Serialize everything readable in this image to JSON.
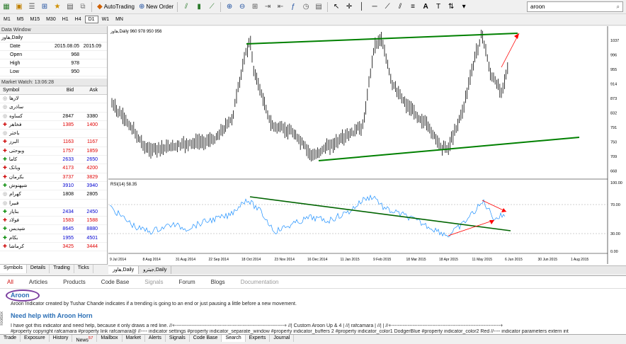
{
  "toolbar": {
    "autotrading": "AutoTrading",
    "new_order": "New Order",
    "search_value": "aroon"
  },
  "timeframes": [
    "M1",
    "M5",
    "M15",
    "M30",
    "H1",
    "H4",
    "D1",
    "W1",
    "MN"
  ],
  "active_timeframe": "D1",
  "data_window": {
    "title": "Data Window",
    "symbol_row": [
      "هاوز,Daily",
      ""
    ],
    "rows": [
      {
        "label": "Date",
        "v1": "2015.08.05",
        "v2": "2015.09"
      },
      {
        "label": "Open",
        "v1": "968",
        "v2": ""
      },
      {
        "label": "High",
        "v1": "978",
        "v2": ""
      },
      {
        "label": "Low",
        "v1": "950",
        "v2": ""
      }
    ]
  },
  "market_watch": {
    "title": "Market Watch: 13:06:28",
    "headers": {
      "symbol": "Symbol",
      "bid": "Bid",
      "ask": "Ask"
    },
    "rows": [
      {
        "symbol": "لازها",
        "bid": "",
        "ask": "",
        "color": ""
      },
      {
        "symbol": "ساذری",
        "bid": "",
        "ask": "",
        "color": ""
      },
      {
        "symbol": "کساوه",
        "bid": "2847",
        "ask": "3380",
        "color": ""
      },
      {
        "symbol": "فخاهر",
        "bid": "1385",
        "ask": "1400",
        "color": "red"
      },
      {
        "symbol": "باختر",
        "bid": "",
        "ask": "",
        "color": ""
      },
      {
        "symbol": "البرز",
        "bid": "1163",
        "ask": "1167",
        "color": "red"
      },
      {
        "symbol": "وبوحتی",
        "bid": "1757",
        "ask": "1859",
        "color": "red"
      },
      {
        "symbol": "کاما",
        "bid": "2633",
        "ask": "2650",
        "color": "blue"
      },
      {
        "symbol": "وبانک",
        "bid": "4173",
        "ask": "4200",
        "color": "red"
      },
      {
        "symbol": "بکرمان",
        "bid": "3737",
        "ask": "3829",
        "color": "red"
      },
      {
        "symbol": "شپهنوش",
        "bid": "3910",
        "ask": "3940",
        "color": "blue"
      },
      {
        "symbol": "کهرام",
        "bid": "1808",
        "ask": "2805",
        "color": ""
      },
      {
        "symbol": "فبیرا",
        "bid": "",
        "ask": "",
        "color": ""
      },
      {
        "symbol": "بناپاز",
        "bid": "2434",
        "ask": "2450",
        "color": "blue"
      },
      {
        "symbol": "فولاد",
        "bid": "1583",
        "ask": "1588",
        "color": "red"
      },
      {
        "symbol": "شپدیس",
        "bid": "8645",
        "ask": "8880",
        "color": "blue"
      },
      {
        "symbol": "بکام",
        "bid": "1955",
        "ask": "4501",
        "color": "blue"
      },
      {
        "symbol": "کرماشا",
        "bid": "3425",
        "ask": "3444",
        "color": "red"
      }
    ]
  },
  "left_tabs": [
    "Symbols",
    "Details",
    "Trading",
    "Ticks"
  ],
  "chart": {
    "header": "هاوز,Daily  960 978 950 956",
    "price_ticks": [
      "1037",
      "996",
      "955",
      "914",
      "873",
      "832",
      "791",
      "750",
      "709",
      "668"
    ],
    "rsi_label": "RSI(14) 58.35",
    "rsi_ticks": [
      "100.00",
      "70.00",
      "30.00",
      "0.00"
    ],
    "date_ticks": [
      "9 Jul 2014",
      "8 Aug 2014",
      "31 Aug 2014",
      "22 Sep 2014",
      "18 Oct 2014",
      "23 Nov 2014",
      "16 Dec 2014",
      "11 Jan 2015",
      "9 Feb 2015",
      "18 Mar 2015",
      "18 Apr 2015",
      "11 May 2015",
      "6 Jun 2015",
      "30 Jun 2015",
      "1 Aug 2015"
    ],
    "tabs": [
      "هاوز,Daily",
      "جیترو,Daily"
    ],
    "colors": {
      "up_line": "#008000",
      "rsi": "#1e90ff",
      "arrow": "#ff0000"
    }
  },
  "bottom": {
    "tabs": [
      "All",
      "Articles",
      "Products",
      "Code Base",
      "Signals",
      "Forum",
      "Blogs",
      "Documentation"
    ],
    "title": "Aroon",
    "description": "Aroon Indicator created by Tushar Chande indicates if a trending is going to an end or just pausing a little before a new movement.",
    "help_title": "Need help with Aroon Horn",
    "text1": "I have got this indicator and need help, because it only draws a red line. //+------------------------------------------------------------------+ //| Custom Aroon Up & 4 | //| rafcamara | //| | //+------------------------------------------------------------------+",
    "text2": "#property copyright rafcamara #property link rafcamara@ //---- indicator settings #property indicator_separate_window #property indicator_buffers 2 #property indicator_color1 DodgerBlue #property indicator_color2 Red //---- indicator parameters extern int"
  },
  "terminal_tabs": [
    "Trade",
    "Exposure",
    "History",
    "News",
    "Mailbox",
    "Market",
    "Alerts",
    "Signals",
    "Code Base",
    "Search",
    "Experts",
    "Journal"
  ],
  "news_badge": "57",
  "toolbox_label": "Toolbox"
}
